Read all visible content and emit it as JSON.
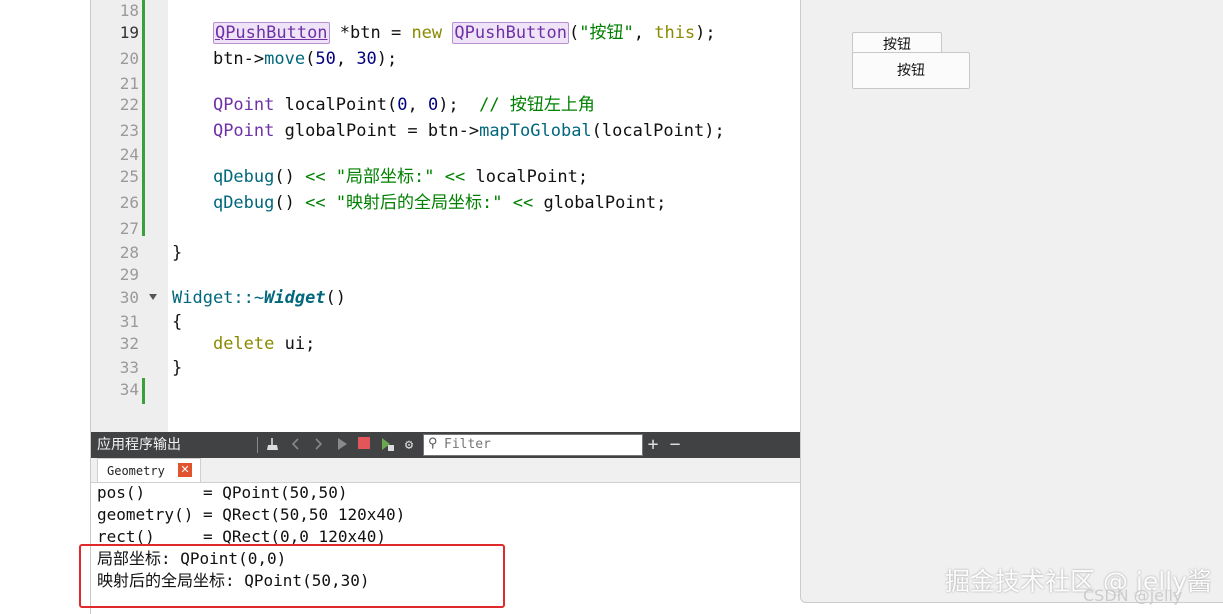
{
  "editor": {
    "lines": [
      {
        "num": "18",
        "current": false
      },
      {
        "num": "19",
        "current": true
      },
      {
        "num": "20",
        "current": false
      },
      {
        "num": "21",
        "current": false
      },
      {
        "num": "22",
        "current": false
      },
      {
        "num": "23",
        "current": false
      },
      {
        "num": "24",
        "current": false
      },
      {
        "num": "25",
        "current": false
      },
      {
        "num": "26",
        "current": false
      },
      {
        "num": "27",
        "current": false
      },
      {
        "num": "28",
        "current": false
      },
      {
        "num": "29",
        "current": false
      },
      {
        "num": "30",
        "current": false
      },
      {
        "num": "31",
        "current": false
      },
      {
        "num": "32",
        "current": false
      },
      {
        "num": "33",
        "current": false
      },
      {
        "num": "34",
        "current": false
      }
    ],
    "code": {
      "l19": {
        "indent": "    ",
        "type": "QPushButton",
        "mid": " *btn = ",
        "kw_new": "new",
        "ctor": "QPushButton",
        "args_open": "(",
        "str": "\"按钮\"",
        "comma": ", ",
        "kw_this": "this",
        "end": ");"
      },
      "l20": {
        "indent": "    ",
        "obj": "btn->",
        "fn": "move",
        "open": "(",
        "n1": "50",
        "comma": ", ",
        "n2": "30",
        "end": ");"
      },
      "l22": {
        "indent": "    ",
        "type": "QPoint",
        "mid": " localPoint(",
        "n1": "0",
        "comma": ", ",
        "n2": "0",
        "end": ");  ",
        "comment": "// 按钮左上角"
      },
      "l23": {
        "indent": "    ",
        "type": "QPoint",
        "mid": " globalPoint = btn->",
        "fn": "mapToGlobal",
        "end": "(localPoint);"
      },
      "l25": {
        "indent": "    ",
        "fn": "qDebug",
        "paren": "() ",
        "op": "<<",
        "str": " \"局部坐标:\" ",
        "op2": "<<",
        "end": " localPoint;"
      },
      "l26": {
        "indent": "    ",
        "fn": "qDebug",
        "paren": "() ",
        "op": "<<",
        "str": " \"映射后的全局坐标:\" ",
        "op2": "<<",
        "end": " globalPoint;"
      },
      "l28": {
        "text": "}"
      },
      "l30": {
        "cls": "Widget::~",
        "fn": "Widget",
        "end": "()"
      },
      "l31": {
        "text": "{"
      },
      "l32": {
        "indent": "    ",
        "kw": "delete",
        "end": " ui;"
      },
      "l33": {
        "text": "}"
      }
    }
  },
  "output_pane": {
    "title": "应用程序输出",
    "filter_placeholder": "Filter",
    "plus_label": "+",
    "minus_label": "−",
    "tab_label": "Geometry",
    "lines": [
      "pos()      = QPoint(50,50)",
      "geometry() = QRect(50,50 120x40)",
      "rect()     = QRect(0,0 120x40)",
      "局部坐标: QPoint(0,0)",
      "映射后的全局坐标: QPoint(50,30)"
    ]
  },
  "widget_window": {
    "button1_label": "按钮",
    "button2_label": "按钮"
  },
  "watermark": {
    "main": "掘金技术社区 @ jelly酱",
    "sub": "CSDN @jelly"
  }
}
